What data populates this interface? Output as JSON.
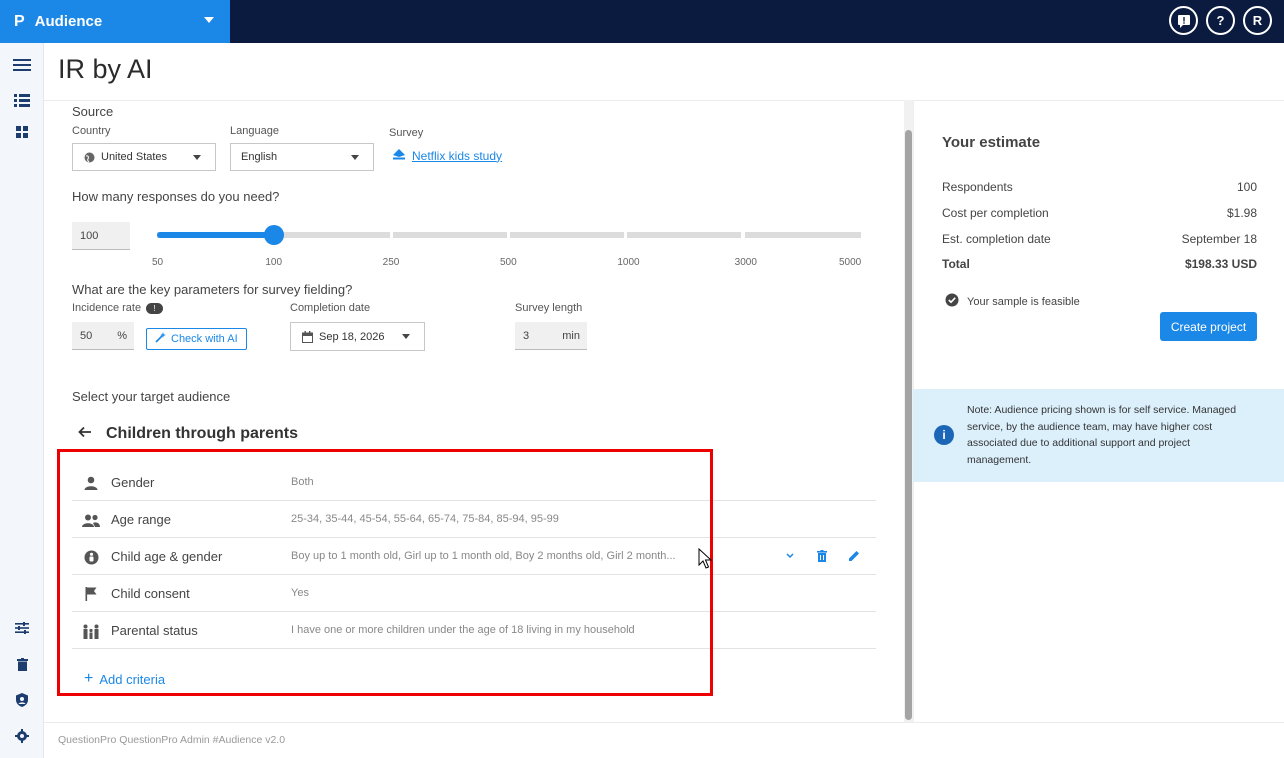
{
  "app": {
    "logo": "P",
    "name": "Audience"
  },
  "topbar": {
    "feedback_icon": "feedback-icon",
    "help_label": "?",
    "avatar_label": "R"
  },
  "page": {
    "title": "IR by AI"
  },
  "source": {
    "heading": "Source",
    "country_label": "Country",
    "country_value": "United States",
    "language_label": "Language",
    "language_value": "English",
    "survey_label": "Survey",
    "survey_value": "Netflix kids study"
  },
  "responses": {
    "heading": "How many responses do you need?",
    "value": "100",
    "ticks": [
      "50",
      "100",
      "250",
      "500",
      "1000",
      "3000",
      "5000"
    ],
    "selected_tick_index": 1
  },
  "params": {
    "heading": "What are the key parameters for survey fielding?",
    "incidence_label": "Incidence rate",
    "incidence_value": "50",
    "incidence_unit": "%",
    "check_ai_label": "Check with AI",
    "completion_label": "Completion date",
    "completion_value": "Sep 18, 2026",
    "length_label": "Survey length",
    "length_value": "3",
    "length_unit": "min"
  },
  "audience": {
    "heading": "Select your target audience",
    "title": "Children through parents",
    "criteria": [
      {
        "icon": "person-icon",
        "name": "Gender",
        "value": "Both"
      },
      {
        "icon": "group-icon",
        "name": "Age range",
        "value": "25-34, 35-44, 45-54, 55-64, 65-74, 75-84, 85-94, 95-99"
      },
      {
        "icon": "child-icon",
        "name": "Child age & gender",
        "value": "Boy up to 1 month old, Girl up to 1 month old, Boy 2 months old, Girl 2 month..."
      },
      {
        "icon": "flag-icon",
        "name": "Child consent",
        "value": "Yes"
      },
      {
        "icon": "family-icon",
        "name": "Parental status",
        "value": "I have one or more children under the age of 18 living in my household"
      }
    ],
    "add_label": "Add criteria"
  },
  "estimate": {
    "title": "Your estimate",
    "rows": [
      {
        "label": "Respondents",
        "value": "100"
      },
      {
        "label": "Cost per completion",
        "value": "$1.98"
      },
      {
        "label": "Est. completion date",
        "value": "September 18"
      },
      {
        "label": "Total",
        "value": "$198.33 USD"
      }
    ],
    "feasible_text": "Your sample is feasible",
    "create_label": "Create project",
    "note": "Note: Audience pricing shown is for self service. Managed service, by the audience team, may have higher cost associated due to additional support and project management."
  },
  "footer": {
    "text": "QuestionPro QuestionPro Admin  #Audience v2.0"
  },
  "colors": {
    "accent": "#1b87e6",
    "topbar": "#0b1b3f",
    "highlight": "#e00000",
    "note_bg": "#dcf0fc"
  }
}
